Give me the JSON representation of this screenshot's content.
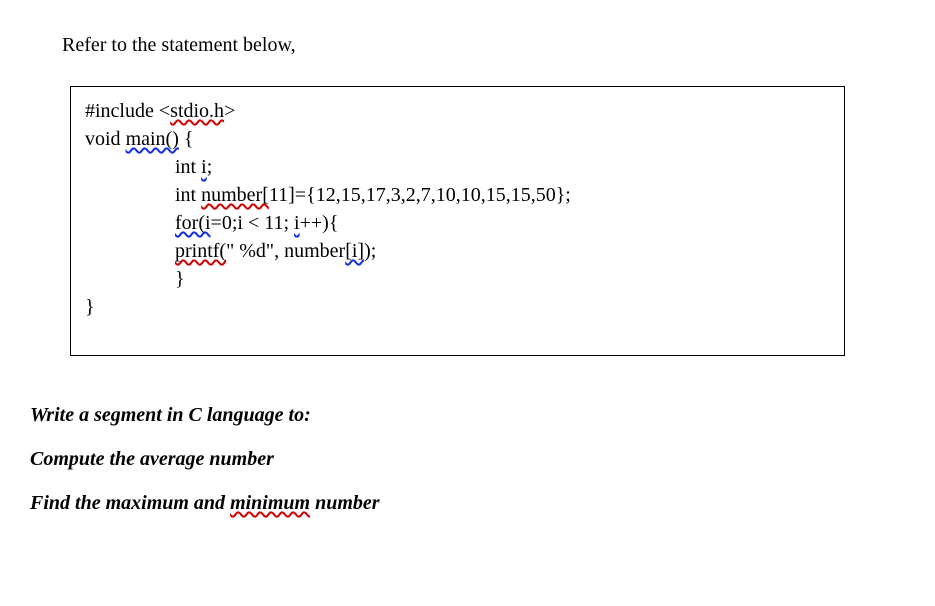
{
  "intro": "Refer to the statement below,",
  "code": {
    "l1_a": "#include <",
    "l1_sq": "stdio.h",
    "l1_b": ">",
    "l2_a": "void ",
    "l2_sq": "main()",
    "l2_b": " {",
    "l3_a": "int ",
    "l3_sq": "i",
    "l3_b": ";",
    "l4_a": "int ",
    "l4_sq": "number[",
    "l4_b": "11]={12,15,17,3,2,7,10,10,15,15,50};",
    "l5_a": "for(i",
    "l5_b": "=0;i < 11; ",
    "l5_sq2": "i",
    "l5_c": "++){",
    "l6_a": "printf(",
    "l6_b": "\" %d\", number",
    "l6_sq": "[i]",
    "l6_c": ");",
    "l7": "}",
    "l8": "}"
  },
  "tasks": {
    "t1": "Write a segment in C language to:",
    "t2": "Compute the average number",
    "t3a": "Find the maximum and ",
    "t3sq": "minimum",
    "t3b": " number"
  }
}
